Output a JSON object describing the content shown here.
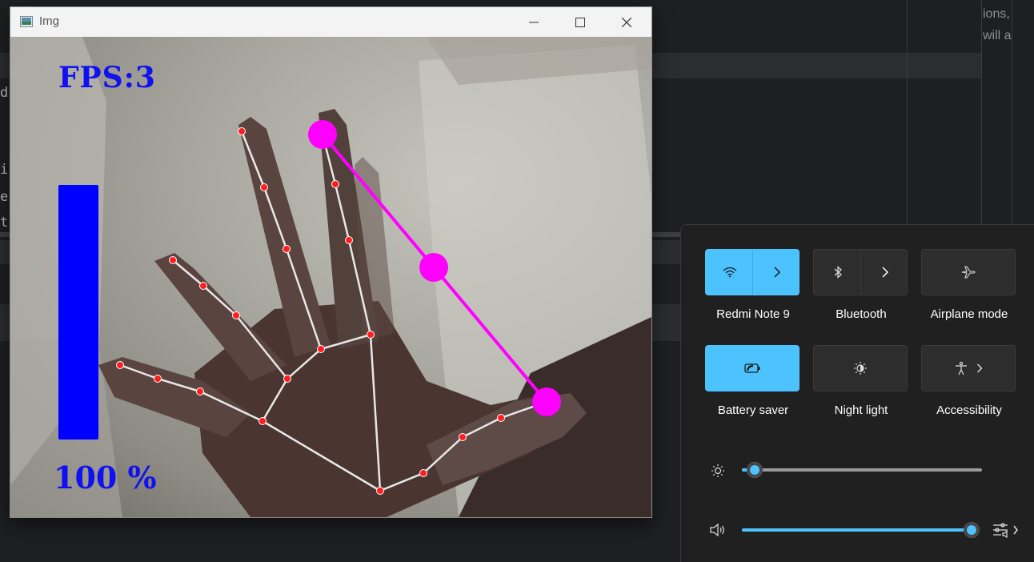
{
  "window": {
    "title": "Img"
  },
  "overlay": {
    "fps_text": "FPS:3",
    "volume_percent_text": "100 %",
    "volume_level": 1.0,
    "bar_color": "#0000ff",
    "line_color": "#ff00ff"
  },
  "ide": {
    "code_fragments": [
      "d",
      "i",
      "e",
      "t"
    ],
    "right_text": [
      "ions,",
      "will a"
    ]
  },
  "quick_settings": {
    "tiles": [
      {
        "label": "Redmi Note 9",
        "icon": "wifi-icon",
        "active": true,
        "expandable": true
      },
      {
        "label": "Bluetooth",
        "icon": "bluetooth-icon",
        "active": false,
        "expandable": true
      },
      {
        "label": "Airplane mode",
        "icon": "airplane-icon",
        "active": false,
        "expandable": false
      },
      {
        "label": "Battery saver",
        "icon": "battery-saver-icon",
        "active": true,
        "expandable": false
      },
      {
        "label": "Night light",
        "icon": "night-light-icon",
        "active": false,
        "expandable": false
      },
      {
        "label": "Accessibility",
        "icon": "accessibility-icon",
        "active": false,
        "expandable": true
      }
    ],
    "brightness_level": 0.0,
    "volume_level": 1.0,
    "accent_color": "#4cc2ff"
  }
}
